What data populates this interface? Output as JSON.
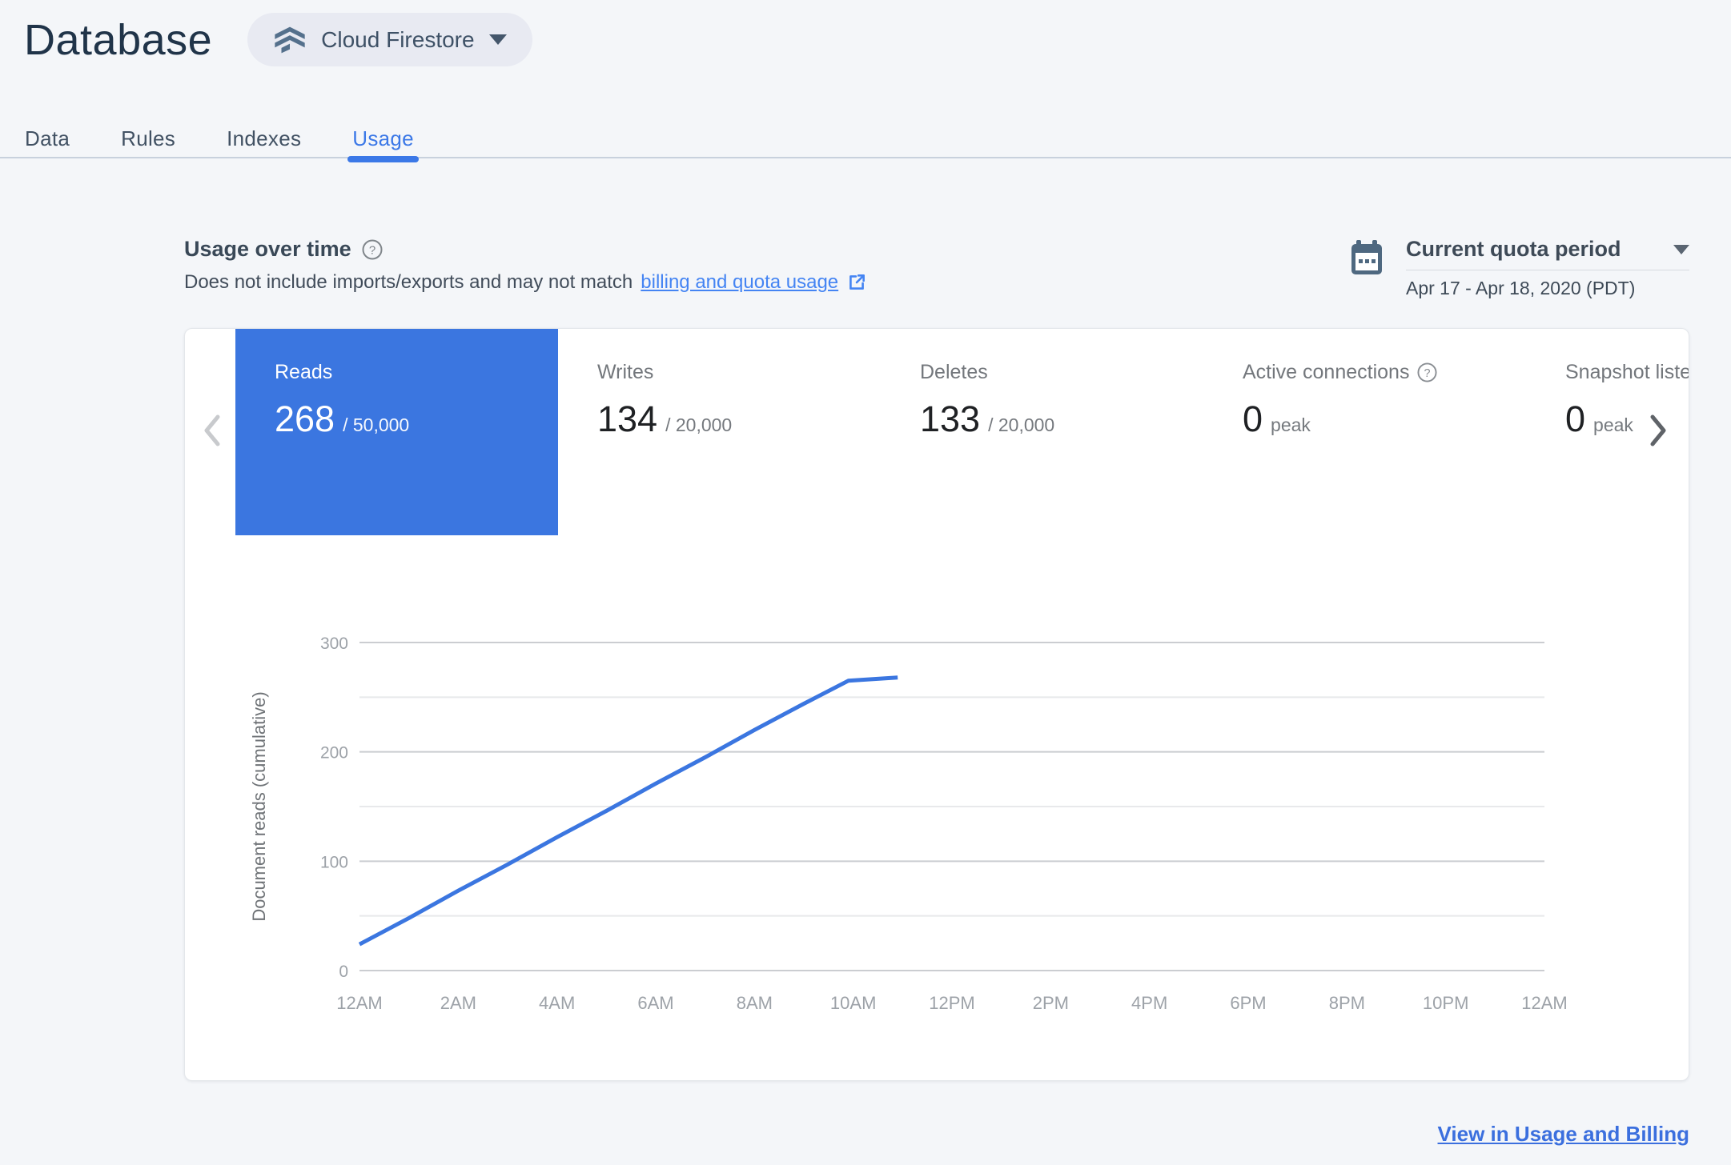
{
  "header": {
    "title": "Database",
    "product_selector": {
      "label": "Cloud Firestore"
    }
  },
  "tabs": [
    {
      "label": "Data",
      "active": false
    },
    {
      "label": "Rules",
      "active": false
    },
    {
      "label": "Indexes",
      "active": false
    },
    {
      "label": "Usage",
      "active": true
    }
  ],
  "usage_section": {
    "heading": "Usage over time",
    "subtext_prefix": "Does not include imports/exports and may not match",
    "link_text": "billing and quota usage",
    "quota_selector": {
      "label": "Current quota period",
      "date_range": "Apr 17 - Apr 18, 2020 (PDT)"
    }
  },
  "metrics": {
    "cards": [
      {
        "label": "Reads",
        "value": "268",
        "denominator": "/ 50,000",
        "selected": true,
        "has_help": false
      },
      {
        "label": "Writes",
        "value": "134",
        "denominator": "/ 20,000",
        "selected": false,
        "has_help": false
      },
      {
        "label": "Deletes",
        "value": "133",
        "denominator": "/ 20,000",
        "selected": false,
        "has_help": false
      },
      {
        "label": "Active connections",
        "value": "0",
        "denominator": "peak",
        "selected": false,
        "has_help": true
      },
      {
        "label": "Snapshot listeners",
        "value": "0",
        "denominator": "peak",
        "selected": false,
        "has_help": false
      }
    ]
  },
  "chart_data": {
    "type": "line",
    "ylabel": "Document reads (cumulative)",
    "xlabel": "",
    "x_tick_labels": [
      "12AM",
      "2AM",
      "4AM",
      "6AM",
      "8AM",
      "10AM",
      "12PM",
      "2PM",
      "4PM",
      "6PM",
      "8PM",
      "10PM",
      "12AM"
    ],
    "x_range_hours": [
      0,
      24
    ],
    "y_ticks_labeled": [
      0,
      100,
      200,
      300
    ],
    "y_ticks_minor": [
      50,
      150,
      250
    ],
    "ylim": [
      0,
      300
    ],
    "grid": true,
    "legend": "none",
    "series": [
      {
        "name": "Document reads (cumulative)",
        "color": "#3B76E0",
        "points_hours_value": [
          [
            0,
            24
          ],
          [
            1,
            48
          ],
          [
            2,
            73
          ],
          [
            3,
            97
          ],
          [
            4,
            122
          ],
          [
            5,
            146
          ],
          [
            6,
            171
          ],
          [
            7,
            195
          ],
          [
            8,
            220
          ],
          [
            9,
            244
          ],
          [
            9.9,
            265
          ],
          [
            10.9,
            268
          ]
        ]
      }
    ]
  },
  "footer": {
    "link_label": "View in Usage and Billing"
  },
  "colors": {
    "accent_blue": "#3B76E0",
    "link_blue": "#4484F3",
    "selected_card_bg": "#3B76E0",
    "page_bg": "#F4F6F9",
    "panel_bg": "#FFFFFF",
    "title_color": "#203449",
    "slate_icon": "#54708C",
    "axis_label_gray": "#9DA2A8",
    "gridline_major": "#CBCDD1",
    "gridline_minor": "#E8E9EB"
  }
}
